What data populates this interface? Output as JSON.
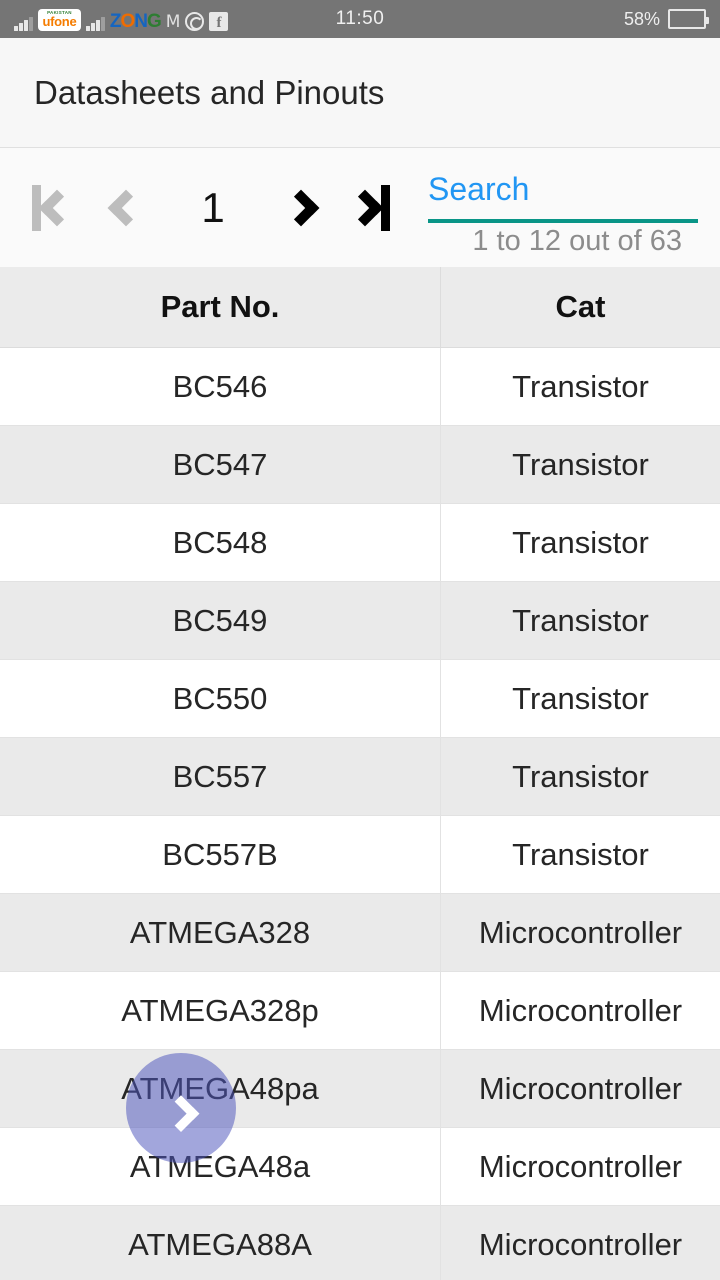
{
  "status_bar": {
    "carrier_1": {
      "brand_small": "PAKISTAN",
      "brand": "ufone"
    },
    "carrier_2": "ZONG",
    "icons": [
      "signal-icon",
      "ufone-logo-icon",
      "signal-icon",
      "zong-logo-icon",
      "gmail-icon",
      "whatsapp-icon",
      "facebook-icon"
    ],
    "gmail_glyph": "M",
    "facebook_glyph": "f",
    "clock": "11:50",
    "battery_percent": "58%",
    "battery_level": 58,
    "background_color": "#757575"
  },
  "app": {
    "title": "Datasheets and Pinouts"
  },
  "toolbar": {
    "first_page_label": "|<",
    "prev_page_label": "<",
    "current_page": "1",
    "next_page_label": ">",
    "last_page_label": ">|",
    "first_enabled": false,
    "prev_enabled": false,
    "next_enabled": true,
    "last_enabled": true,
    "search": {
      "value": "",
      "placeholder": "Search",
      "text_color": "#2196f3",
      "underline_color": "#099587"
    },
    "range_label": "1 to 12 out of 63"
  },
  "table": {
    "columns": [
      "Part No.",
      "Cat"
    ],
    "rows": [
      {
        "part": "BC546",
        "cat": "Transistor"
      },
      {
        "part": "BC547",
        "cat": "Transistor"
      },
      {
        "part": "BC548",
        "cat": "Transistor"
      },
      {
        "part": "BC549",
        "cat": "Transistor"
      },
      {
        "part": "BC550",
        "cat": "Transistor"
      },
      {
        "part": "BC557",
        "cat": "Transistor"
      },
      {
        "part": "BC557B",
        "cat": "Transistor"
      },
      {
        "part": "ATMEGA328",
        "cat": "Microcontroller"
      },
      {
        "part": "ATMEGA328p",
        "cat": "Microcontroller"
      },
      {
        "part": "ATMEGA48pa",
        "cat": "Microcontroller"
      },
      {
        "part": "ATMEGA48a",
        "cat": "Microcontroller"
      },
      {
        "part": "ATMEGA88A",
        "cat": "Microcontroller"
      }
    ]
  },
  "fab": {
    "icon": "chevron-right-icon",
    "color": "#4d54bc"
  }
}
